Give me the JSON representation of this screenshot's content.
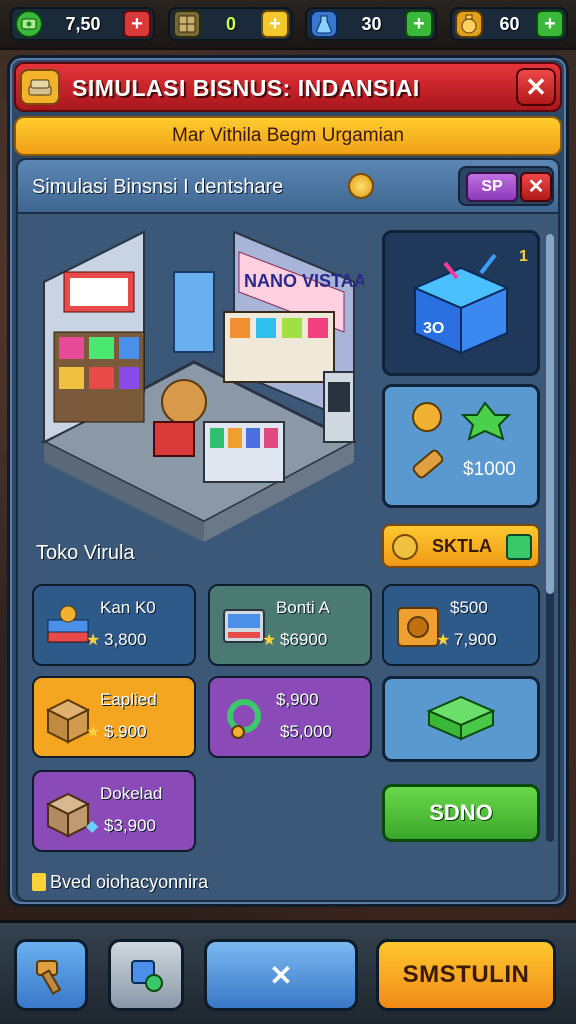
{
  "colors": {
    "title_red": "#c8232a",
    "banner_yellow": "#f8b620",
    "panel_blue": "#2f4866",
    "green_button": "#5ac83a",
    "purple_card": "#8a4ab8",
    "orange_button": "#f5a020"
  },
  "resources": [
    {
      "icon": "cash-icon",
      "value": "7,50",
      "plus": "+"
    },
    {
      "icon": "goods-icon",
      "value": "0",
      "plus": "+"
    },
    {
      "icon": "potion-icon",
      "value": "30",
      "plus": "+"
    },
    {
      "icon": "gold-bag-icon",
      "value": "60",
      "plus": "+"
    }
  ],
  "window": {
    "title": "SIMULASI BISNUS: INDANSIAI",
    "close": "✕",
    "subtitle": "Mar Vithila Begm Urgamian"
  },
  "inner": {
    "title": "Simulasi Binsnsi I dentshare",
    "sp_label": "SP",
    "close": "✕"
  },
  "store": {
    "sign": "NANO VISTAAI",
    "name": "Toko Virula"
  },
  "side": {
    "box_label": "3O",
    "box_count": "1",
    "bundle_price": "$1000",
    "skala_label": "SKTLA"
  },
  "items": [
    {
      "name": "Kan K0",
      "price": "3,800",
      "marker": "★"
    },
    {
      "name": "Bonti A",
      "price": "$6900",
      "marker": "★"
    },
    {
      "name": "$500",
      "price": "7,900",
      "marker": "★"
    },
    {
      "name": "Eaplied",
      "price": "$.900",
      "marker": "★"
    },
    {
      "name": "$,900",
      "price": "$5,000",
      "marker": ""
    },
    {
      "name": "Dokelad",
      "price": "$3,900",
      "marker": "◆"
    }
  ],
  "sdno_label": "SDNO",
  "footer": "Bved oiohacyonnira",
  "bottom": {
    "cancel": "✕",
    "confirm": "SMSTULIN"
  }
}
